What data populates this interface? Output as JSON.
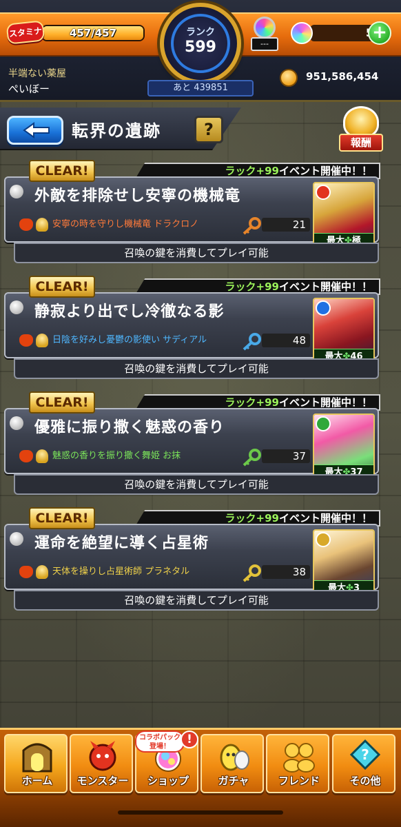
{
  "header": {
    "stamina_label": "スタミナ",
    "stamina_text": "457/457",
    "stamina_fraction": 1.0,
    "rank_label": "ランク",
    "rank_value": "599",
    "rank_next": "あと 439851",
    "item_count": "---",
    "orb_count": "5",
    "plus_symbol": "+",
    "player_title": "半端ない薬屋",
    "player_name": "ぺいぼー",
    "gold": "951,586,454"
  },
  "title_bar": {
    "title": "転界の遺跡",
    "help": "?",
    "reward_label": "報酬"
  },
  "quests": [
    {
      "clear": "CLEAR!",
      "event_green": "ラック+99",
      "event_white": "イベント開催中！！",
      "title": "外敵を排除せし安寧の機械竜",
      "boss": "安寧の時を守りし機械竜 ドラクロノ",
      "boss_color": "#ff7a3a",
      "key_color": "#e6842a",
      "keys": "21",
      "luck_prefix": "最大",
      "luck_value": "極",
      "attr_color": "#e2331f",
      "art": "linear-gradient(160deg,#fff3c2,#d7a53b 40%,#b3172a 70%,#3a1a44)",
      "play_text": "召喚の鍵を消費してプレイ可能"
    },
    {
      "clear": "CLEAR!",
      "event_green": "ラック+99",
      "event_white": "イベント開催中！！",
      "title": "静寂より出でし冷徹なる影",
      "boss": "日陰を好みし憂鬱の影使い サディアル",
      "boss_color": "#4fb7ff",
      "key_color": "#49a9e8",
      "keys": "48",
      "luck_prefix": "最大",
      "luck_value": "46",
      "attr_color": "#1f70e2",
      "art": "linear-gradient(160deg,#ffd2c2,#d9423a 35%,#8a1620 65%,#2a1c3a)",
      "play_text": "召喚の鍵を消費してプレイ可能"
    },
    {
      "clear": "CLEAR!",
      "event_green": "ラック+99",
      "event_white": "イベント開催中！！",
      "title": "優雅に振り撒く魅惑の香り",
      "boss": "魅惑の香りを振り撒く舞姫 お抹",
      "boss_color": "#7be35a",
      "key_color": "#6cc94a",
      "keys": "37",
      "luck_prefix": "最大",
      "luck_value": "37",
      "attr_color": "#2fa83a",
      "art": "linear-gradient(160deg,#ffe2f0,#f25aa6 35%,#7adf7a 70%,#2f6a3a)",
      "play_text": "召喚の鍵を消費してプレイ可能"
    },
    {
      "clear": "CLEAR!",
      "event_green": "ラック+99",
      "event_white": "イベント開催中！！",
      "title": "運命を絶望に導く占星術",
      "boss": "天体を操りし占星術師 プラネタル",
      "boss_color": "#f0d24a",
      "key_color": "#e2c23a",
      "keys": "38",
      "luck_prefix": "最大",
      "luck_value": "3",
      "attr_color": "#d8a92a",
      "art": "linear-gradient(160deg,#fff6d8,#e9c27a 35%,#6a4630 65%,#2a3e6a)",
      "play_text": "召喚の鍵を消費してプレイ可能"
    }
  ],
  "nav": {
    "home": "ホーム",
    "monster": "モンスター",
    "shop": "ショップ",
    "gacha": "ガチャ",
    "friend": "フレンド",
    "other": "その他",
    "collab_badge": "コラボパック登場！",
    "alert": "!"
  }
}
